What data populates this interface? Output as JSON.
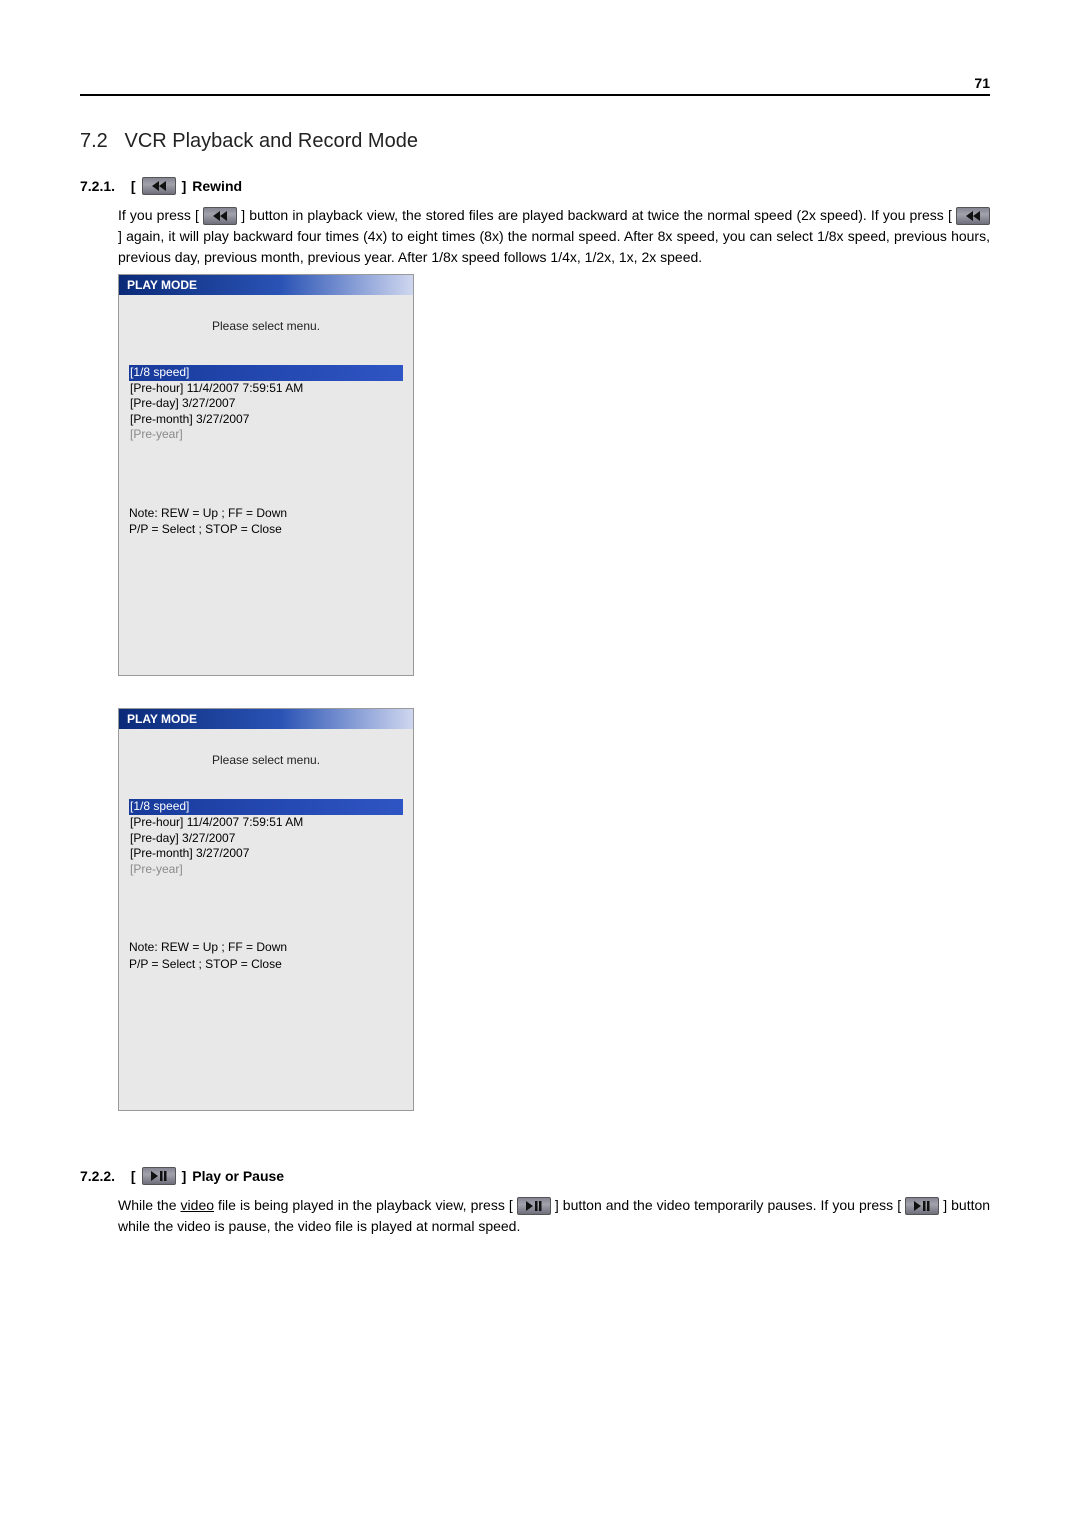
{
  "page": {
    "number": "71"
  },
  "heading": {
    "num": "7.2",
    "title": "VCR Playback and Record Mode"
  },
  "s1": {
    "num": "7.2.1.",
    "bracket_open": "[",
    "bracket_close": "]",
    "label": "Rewind",
    "p1a": "If you press [",
    "p1b": "] button in playback view, the stored files are played backward at twice the normal speed (2x speed). If you press [",
    "p1c": "] again, it will play backward four times (4x) to eight times (8x) the normal speed.   After 8x speed, you can select 1/8x speed, previous hours, previous day, previous month, previous year. After 1/8x speed follows 1/4x, 1/2x, 1x, 2x speed."
  },
  "panel": {
    "title": "PLAY MODE",
    "subtitle": "Please select menu.",
    "items": {
      "i0": "[1/8 speed]",
      "i1": "[Pre-hour] 11/4/2007 7:59:51 AM",
      "i2": "[Pre-day] 3/27/2007",
      "i3": "[Pre-month] 3/27/2007",
      "i4": "[Pre-year]"
    },
    "note1": "Note: REW = Up ; FF = Down",
    "note2": "P/P = Select ; STOP = Close"
  },
  "s2": {
    "num": "7.2.2.",
    "bracket_open": "[",
    "bracket_close": "]",
    "label": "Play or Pause",
    "p1a": "While the ",
    "p1a_u": "video",
    "p1b": " file is being played in the playback view, press [",
    "p1c": "] button and the video temporarily pauses. If you press [",
    "p1d": "] button while the video is pause, the video file is played at normal speed."
  }
}
